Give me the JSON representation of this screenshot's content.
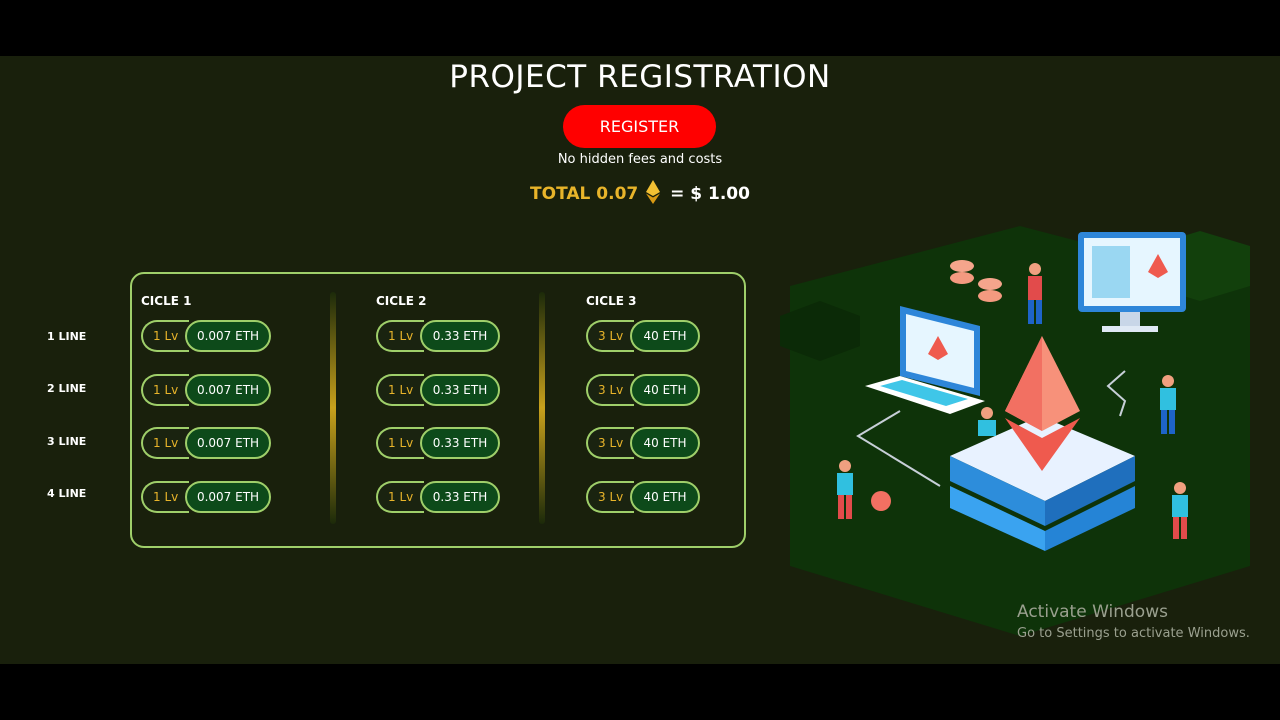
{
  "header": {
    "title": "PROJECT REGISTRATION",
    "register_label": "REGISTER",
    "subtext": "No hidden fees and costs",
    "total_amount": "TOTAL 0.07",
    "total_usd": "= $ 1.00"
  },
  "lines": [
    "1 LINE",
    "2 LINE",
    "3 LINE",
    "4 LINE"
  ],
  "cycles": [
    {
      "title": "CICLE 1",
      "rows": [
        {
          "lv": "1 Lv",
          "eth": "0.007 ETH"
        },
        {
          "lv": "1 Lv",
          "eth": "0.007 ETH"
        },
        {
          "lv": "1 Lv",
          "eth": "0.007 ETH"
        },
        {
          "lv": "1 Lv",
          "eth": "0.007 ETH"
        }
      ]
    },
    {
      "title": "CICLE 2",
      "rows": [
        {
          "lv": "1 Lv",
          "eth": "0.33 ETH"
        },
        {
          "lv": "1 Lv",
          "eth": "0.33 ETH"
        },
        {
          "lv": "1 Lv",
          "eth": "0.33 ETH"
        },
        {
          "lv": "1 Lv",
          "eth": "0.33 ETH"
        }
      ]
    },
    {
      "title": "CICLE 3",
      "rows": [
        {
          "lv": "3 Lv",
          "eth": "40 ETH"
        },
        {
          "lv": "3 Lv",
          "eth": "40 ETH"
        },
        {
          "lv": "3 Lv",
          "eth": "40 ETH"
        },
        {
          "lv": "3 Lv",
          "eth": "40 ETH"
        }
      ]
    }
  ],
  "watermark": {
    "line1": "Activate Windows",
    "line2": "Go to Settings to activate Windows."
  },
  "colors": {
    "background": "#19200c",
    "register": "#ff0000",
    "accent_gold": "#e8b42a",
    "border_green": "#9fcf6a",
    "pill_green": "#0d4a1a"
  },
  "icons": {
    "eth": "ethereum-icon",
    "illustration": "ethereum-platform-illustration"
  }
}
